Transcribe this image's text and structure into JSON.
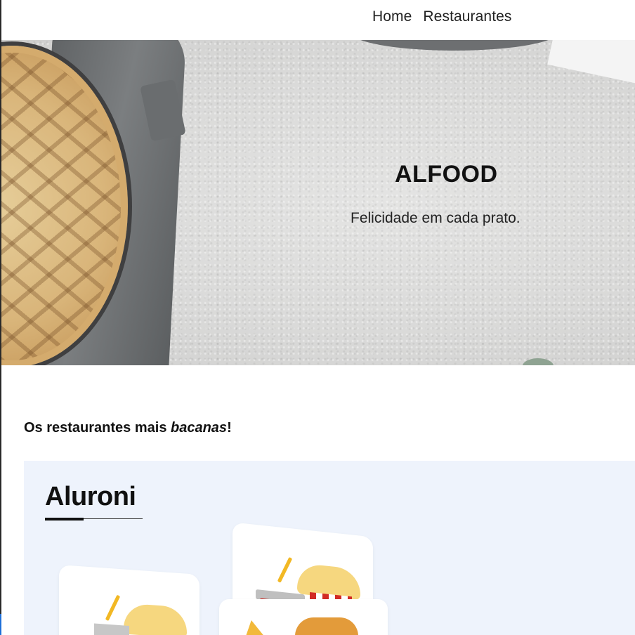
{
  "nav": {
    "links": [
      "Home",
      "Restaurantes"
    ]
  },
  "hero": {
    "title": "ALFOOD",
    "subtitle": "Felicidade em cada prato."
  },
  "section": {
    "title_prefix": "Os restaurantes mais ",
    "title_emphasis": "bacanas",
    "title_suffix": "!"
  },
  "restaurant": {
    "name": "Aluroni"
  },
  "colors": {
    "card_background": "#eef3fc",
    "accent_red": "#d22b25",
    "accent_yellow": "#f6d77f"
  }
}
